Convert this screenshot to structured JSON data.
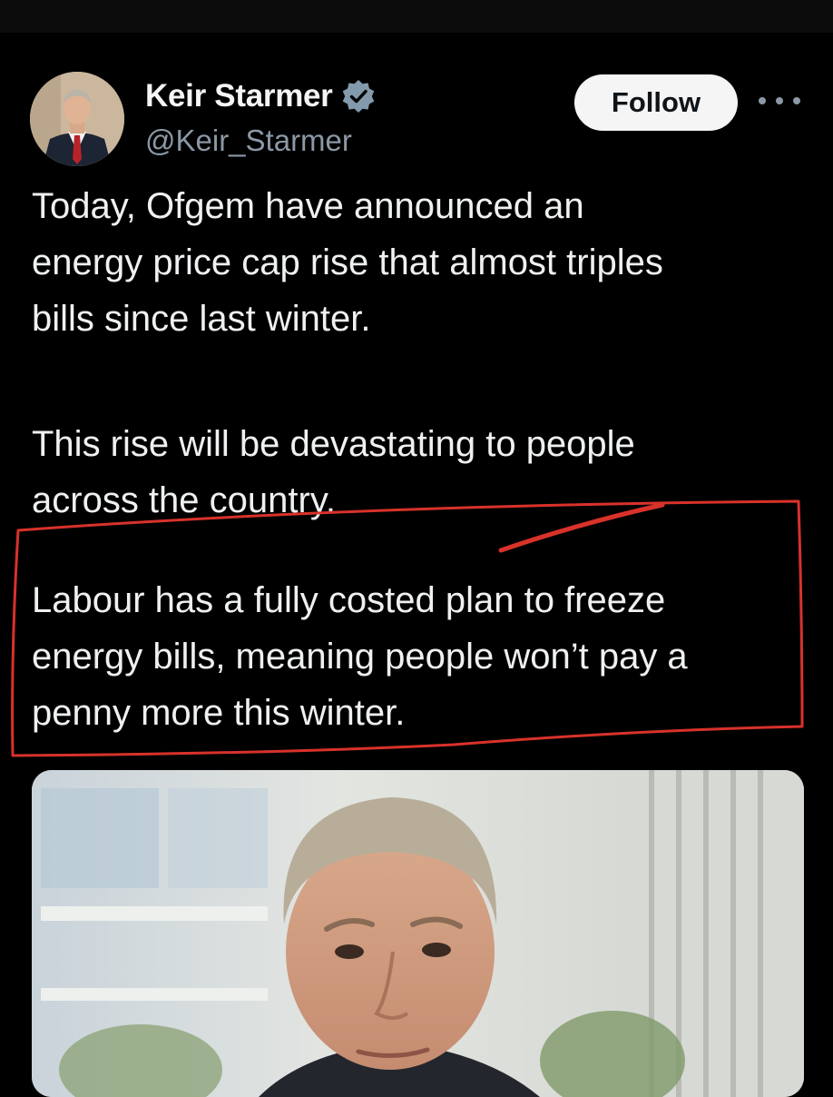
{
  "author": {
    "name": "Keir Starmer",
    "handle": "@Keir_Starmer",
    "verified_icon": "verified-badge-icon",
    "avatar_icon": "profile-photo"
  },
  "actions": {
    "follow_label": "Follow",
    "more_icon": "more-options-icon"
  },
  "tweet": {
    "paragraph_1": "Today, Ofgem have announced an\nenergy price cap rise that almost triples\nbills since last winter.",
    "paragraph_2": "This rise will be devastating to people\nacross the country.",
    "paragraph_3": "Labour has a fully costed plan to freeze\nenergy bills, meaning people won’t pay a\npenny more this winter."
  },
  "annotation": {
    "color": "#d8322a"
  },
  "media": {
    "type": "photo"
  },
  "colors": {
    "background": "#000000",
    "text": "#eef0f1",
    "secondary_text": "#8b98a5",
    "verified_badge": "#829aab",
    "follow_button_bg": "#f5f5f5"
  }
}
